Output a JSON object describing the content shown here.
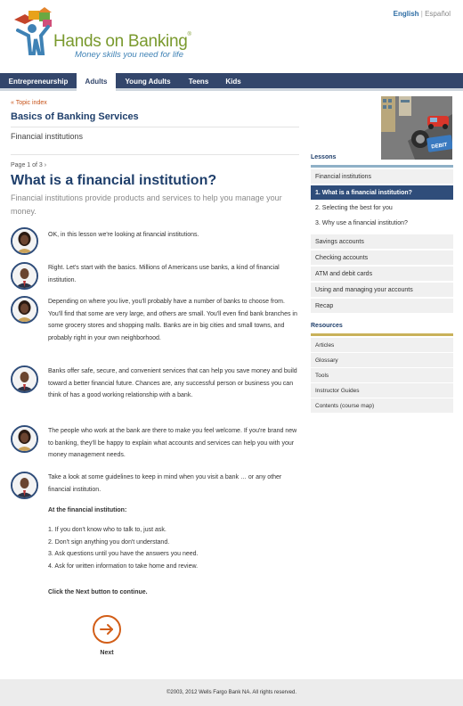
{
  "header": {
    "language_english": "English",
    "language_separator": "|",
    "language_spanish": "Español",
    "logo_text": "Hands on Banking",
    "logo_trademark": "®",
    "tagline": "Money skills you need for life"
  },
  "nav": {
    "items": [
      {
        "label": "Entrepreneurship",
        "active": false
      },
      {
        "label": "Adults",
        "active": true
      },
      {
        "label": "Young Adults",
        "active": false
      },
      {
        "label": "Teens",
        "active": false
      },
      {
        "label": "Kids",
        "active": false
      }
    ]
  },
  "breadcrumb": {
    "topic_index": "« Topic index"
  },
  "section": {
    "title": "Basics of Banking Services",
    "subtitle": "Financial institutions"
  },
  "lesson": {
    "page_indicator": "Page 1 of 3 ›",
    "title": "What is a financial institution?",
    "intro": "Financial institutions provide products and services to help you manage your money."
  },
  "messages": [
    {
      "speaker": "woman",
      "text": "OK, in this lesson we're looking at financial institutions."
    },
    {
      "speaker": "man",
      "text": "Right. Let's start with the basics. Millions of Americans use banks, a kind of financial institution."
    },
    {
      "speaker": "woman",
      "text": "Depending on where you live, you'll probably have a number of banks to choose from. You'll find that some are very large, and others are small. You'll even find bank branches in some grocery stores and shopping malls. Banks are in big cities and small towns, and probably right in your own neighborhood."
    },
    {
      "speaker": "man",
      "text": "Banks offer safe, secure, and convenient services that can help you save money and build toward a better financial future. Chances are, any successful person or business you can think of has a good working relationship with a bank."
    },
    {
      "speaker": "woman",
      "text": "The people who work at the bank are there to make you feel welcome. If you're brand new to banking, they'll be happy to explain what accounts and services can help you with your money management needs."
    },
    {
      "speaker": "man",
      "text": "Take a look at some guidelines to keep in mind when you visit a bank … or any other financial institution."
    }
  ],
  "guidelines": {
    "title": "At the financial institution:",
    "items": [
      "1.  If you don't know who to talk to, just ask.",
      "2.  Don't sign anything you don't understand.",
      "3.  Ask questions until you have the answers you need.",
      "4.  Ask for written information to take home and review."
    ],
    "next_note": "Click the Next button to continue."
  },
  "next_button": {
    "label": "Next"
  },
  "sidebar": {
    "lessons_heading": "Lessons",
    "lessons": [
      {
        "label": "Financial institutions",
        "kind": "parent"
      },
      {
        "label": "1. What is a financial institution?",
        "kind": "active"
      },
      {
        "label": "2. Selecting the best for you",
        "kind": "sub"
      },
      {
        "label": "3. Why use a financial institution?",
        "kind": "sub"
      },
      {
        "label": "Savings accounts",
        "kind": "normal"
      },
      {
        "label": "Checking accounts",
        "kind": "normal"
      },
      {
        "label": "ATM and debit cards",
        "kind": "normal"
      },
      {
        "label": "Using and managing your accounts",
        "kind": "normal"
      },
      {
        "label": "Recap",
        "kind": "normal"
      }
    ],
    "resources_heading": "Resources",
    "resources": [
      "Articles",
      "Glossary",
      "Tools",
      "Instructor Guides",
      "Contents (course map)"
    ]
  },
  "hero_image": {
    "card_text": "DEBIT"
  },
  "footer": {
    "copyright": "©2003, 2012 Wells Fargo Bank NA. All rights reserved."
  },
  "colors": {
    "navy": "#33466b",
    "title_blue": "#1f3f6b",
    "accent_orange": "#d25e18",
    "logo_green": "#7a9a2e",
    "logo_blue": "#3f82b5",
    "lessons_bar": "#8fb0c7",
    "resources_bar": "#c9b25a"
  }
}
